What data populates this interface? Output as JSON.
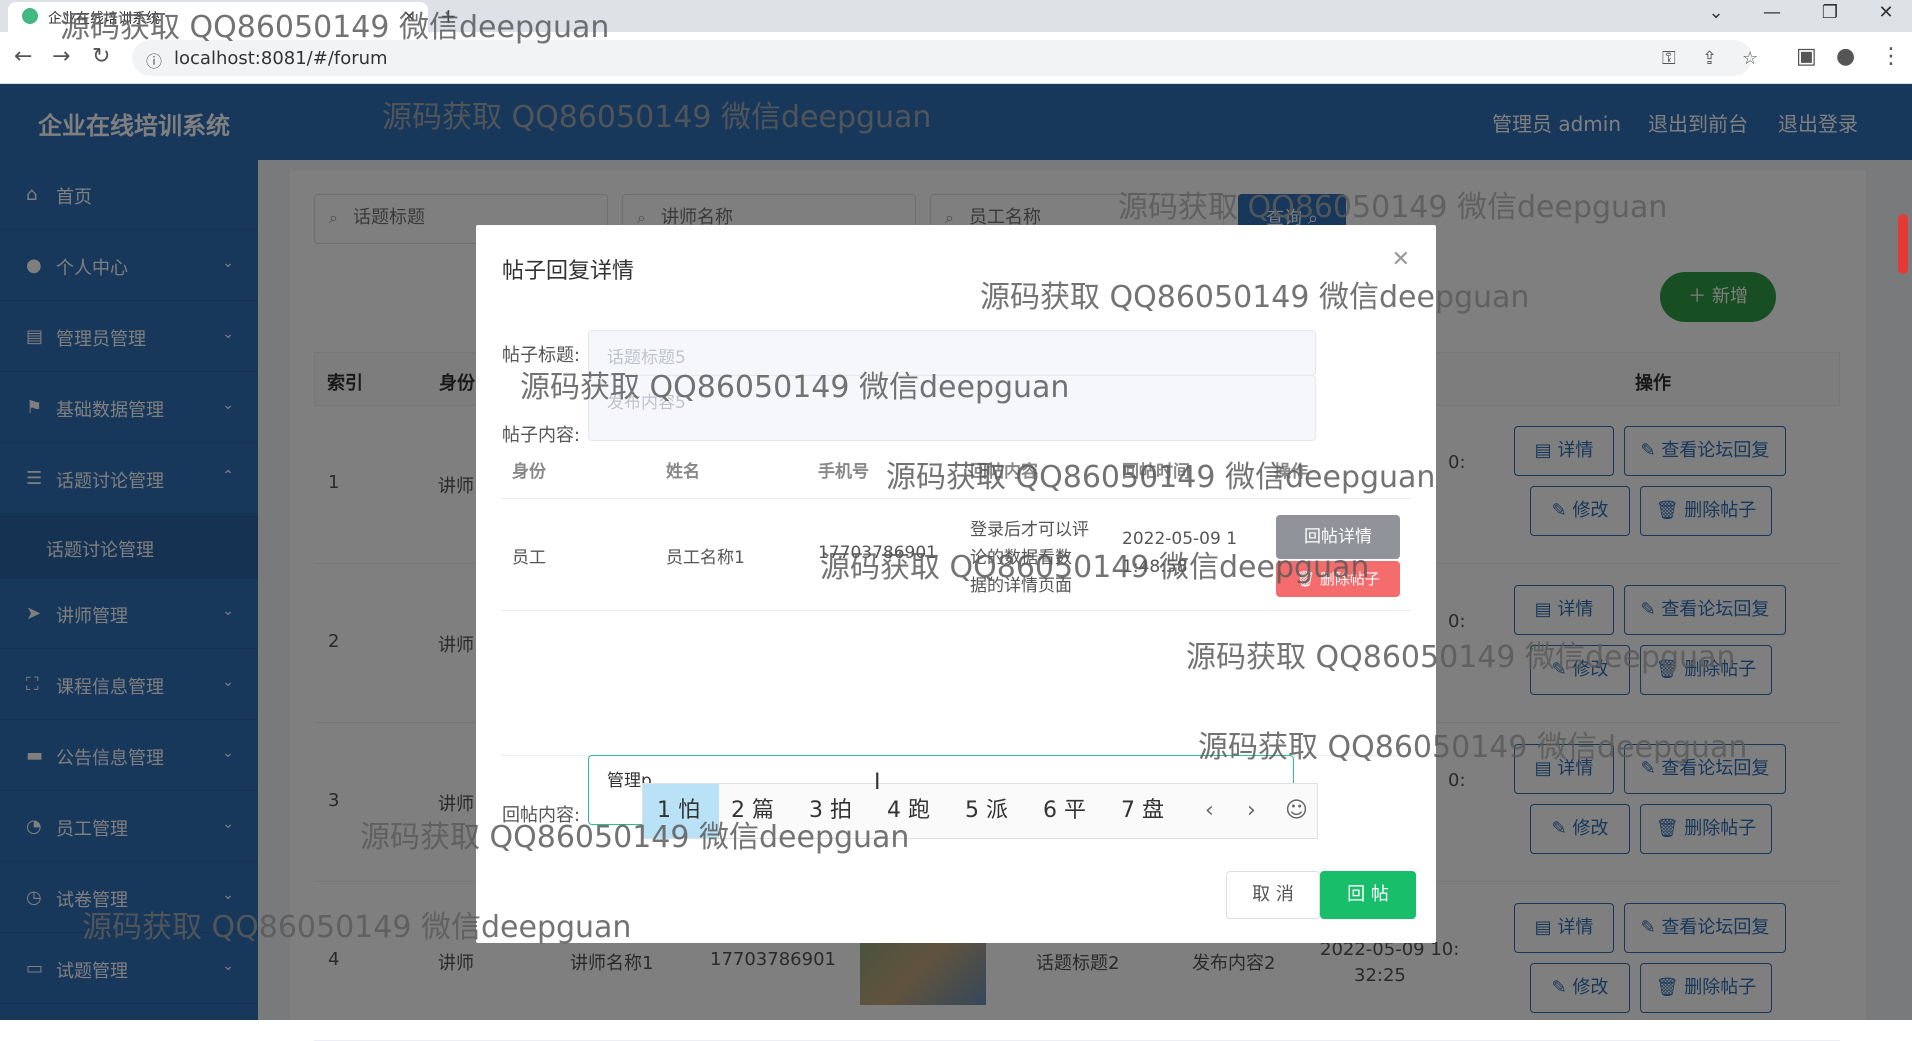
{
  "browser": {
    "tab_title": "企业在线培训系统",
    "url": "localhost:8081/#/forum",
    "new_tab": "+",
    "close_tab": "×"
  },
  "header": {
    "app_title": "企业在线培训系统",
    "admin_label": "管理员 admin",
    "back_front": "退出到前台",
    "logout": "退出登录"
  },
  "sidebar": {
    "items": [
      {
        "label": "首页"
      },
      {
        "label": "个人中心"
      },
      {
        "label": "管理员管理"
      },
      {
        "label": "基础数据管理"
      },
      {
        "label": "话题讨论管理"
      },
      {
        "label": "话题讨论管理"
      },
      {
        "label": "讲师管理"
      },
      {
        "label": "课程信息管理"
      },
      {
        "label": "公告信息管理"
      },
      {
        "label": "员工管理"
      },
      {
        "label": "试卷管理"
      },
      {
        "label": "试题管理"
      }
    ]
  },
  "search": {
    "topic_placeholder": "话题标题",
    "teacher_placeholder": "讲师名称",
    "staff_placeholder": "员工名称",
    "query_label": "查询",
    "add_label": "新增"
  },
  "table": {
    "headers": {
      "index": "索引",
      "identity": "身份",
      "ops": "操作"
    },
    "rows": [
      {
        "index": "1",
        "identity": "讲师",
        "time_tail": "0:"
      },
      {
        "index": "2",
        "identity": "讲师",
        "time_tail": "0:"
      },
      {
        "index": "3",
        "identity": "讲师",
        "time_tail": "0:"
      },
      {
        "index": "4",
        "identity": "讲师",
        "name": "讲师名称1",
        "phone": "17703786901",
        "title": "话题标题2",
        "content": "发布内容2",
        "time": "2022-05-09 10:",
        "time2": "32:25"
      }
    ],
    "ops": {
      "detail": "详情",
      "view_reply": "查看论坛回复",
      "edit": "修改",
      "delete": "删除帖子"
    }
  },
  "dialog": {
    "title": "帖子回复详情",
    "post_title_label": "帖子标题:",
    "post_title_value": "话题标题5",
    "post_content_label": "帖子内容:",
    "post_content_value": "发布内容5",
    "inner_headers": {
      "identity": "身份",
      "name": "姓名",
      "phone": "手机号",
      "content": "回帖内容",
      "time": "回帖时间",
      "ops": "操作"
    },
    "inner_row": {
      "identity": "员工",
      "name": "员工名称1",
      "phone": "17703786901",
      "content_l1": "登录后才可以评",
      "content_l2": "论的数据看数",
      "content_l3": "据的详情页面",
      "time_l1": "2022-05-09 1",
      "time_l2": "1:48:58",
      "detail_btn": "回帖详情",
      "delete_btn": "删除帖子"
    },
    "reply_label": "回帖内容:",
    "reply_value": "管理p",
    "cancel": "取 消",
    "submit": "回 帖"
  },
  "ime": {
    "candidates": [
      "1 怕",
      "2 篇",
      "3 拍",
      "4 跑",
      "5 派",
      "6 平",
      "7 盘"
    ],
    "prev": "‹",
    "next": "›",
    "emoji": "☺"
  },
  "watermark": "源码获取 QQ86050149 微信deepguan"
}
